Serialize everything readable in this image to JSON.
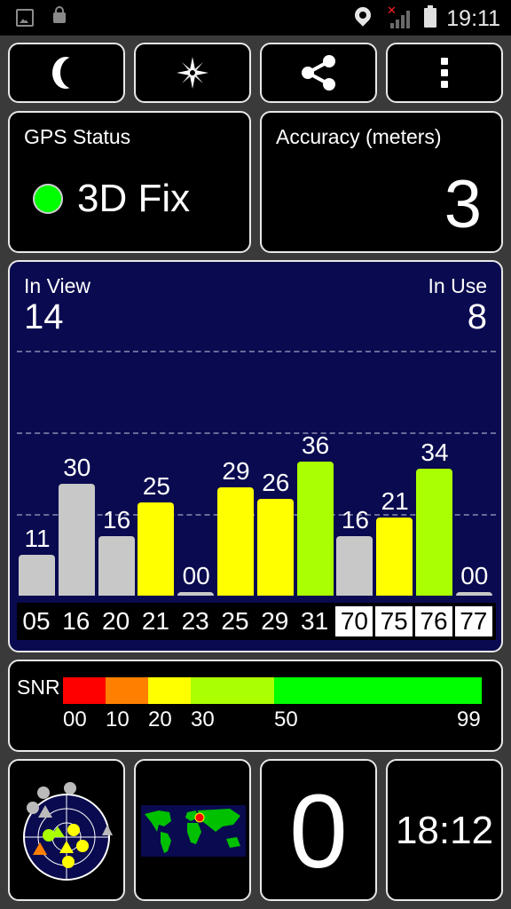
{
  "status_bar": {
    "time": "19:11"
  },
  "toolbar": {
    "night_mode": "moon-icon",
    "compass": "compass-icon",
    "share": "share-icon",
    "menu": "overflow-menu-icon"
  },
  "gps_status": {
    "label": "GPS Status",
    "value": "3D Fix",
    "indicator_color": "#00ff00"
  },
  "accuracy": {
    "label": "Accuracy (meters)",
    "value": "3"
  },
  "satellites": {
    "in_view_label": "In View",
    "in_view": "14",
    "in_use_label": "In Use",
    "in_use": "8",
    "bars": [
      {
        "prn": "05",
        "snr": "11",
        "color": "#c8c8c8",
        "highlight": false
      },
      {
        "prn": "16",
        "snr": "30",
        "color": "#c8c8c8",
        "highlight": false
      },
      {
        "prn": "20",
        "snr": "16",
        "color": "#c8c8c8",
        "highlight": false
      },
      {
        "prn": "21",
        "snr": "25",
        "color": "#ffff00",
        "highlight": false
      },
      {
        "prn": "23",
        "snr": "00",
        "color": "#c8c8c8",
        "highlight": false
      },
      {
        "prn": "25",
        "snr": "29",
        "color": "#ffff00",
        "highlight": false
      },
      {
        "prn": "29",
        "snr": "26",
        "color": "#ffff00",
        "highlight": false
      },
      {
        "prn": "31",
        "snr": "36",
        "color": "#aaff00",
        "highlight": false
      },
      {
        "prn": "70",
        "snr": "16",
        "color": "#c8c8c8",
        "highlight": true
      },
      {
        "prn": "75",
        "snr": "21",
        "color": "#ffff00",
        "highlight": true
      },
      {
        "prn": "76",
        "snr": "34",
        "color": "#aaff00",
        "highlight": true
      },
      {
        "prn": "77",
        "snr": "00",
        "color": "#c8c8c8",
        "highlight": true
      }
    ]
  },
  "snr_legend": {
    "label": "SNR",
    "ticks": [
      "00",
      "10",
      "20",
      "30",
      "50",
      "99"
    ],
    "colors": [
      "#ff0000",
      "#ff8000",
      "#ffff00",
      "#aaff00",
      "#00ff00"
    ]
  },
  "bottom": {
    "radar": "sky-radar-icon",
    "map": "world-map-icon",
    "speed": "0",
    "clock": "18:12"
  }
}
